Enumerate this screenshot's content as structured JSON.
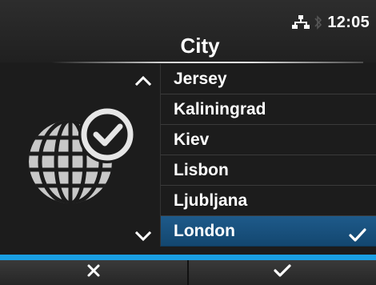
{
  "header": {
    "time": "12:05",
    "title": "City",
    "status_icons": [
      "network-icon",
      "bluetooth-icon"
    ]
  },
  "list": {
    "items": [
      {
        "label": "Jersey",
        "selected": false
      },
      {
        "label": "Kaliningrad",
        "selected": false
      },
      {
        "label": "Kiev",
        "selected": false
      },
      {
        "label": "Lisbon",
        "selected": false
      },
      {
        "label": "Ljubljana",
        "selected": false
      },
      {
        "label": "London",
        "selected": true
      }
    ]
  },
  "footer": {
    "cancel_icon": "close-icon",
    "confirm_icon": "check-icon"
  },
  "colors": {
    "accent": "#1a9fe3",
    "selected_row": "#1e5a8a",
    "background": "#1c1c1c"
  }
}
